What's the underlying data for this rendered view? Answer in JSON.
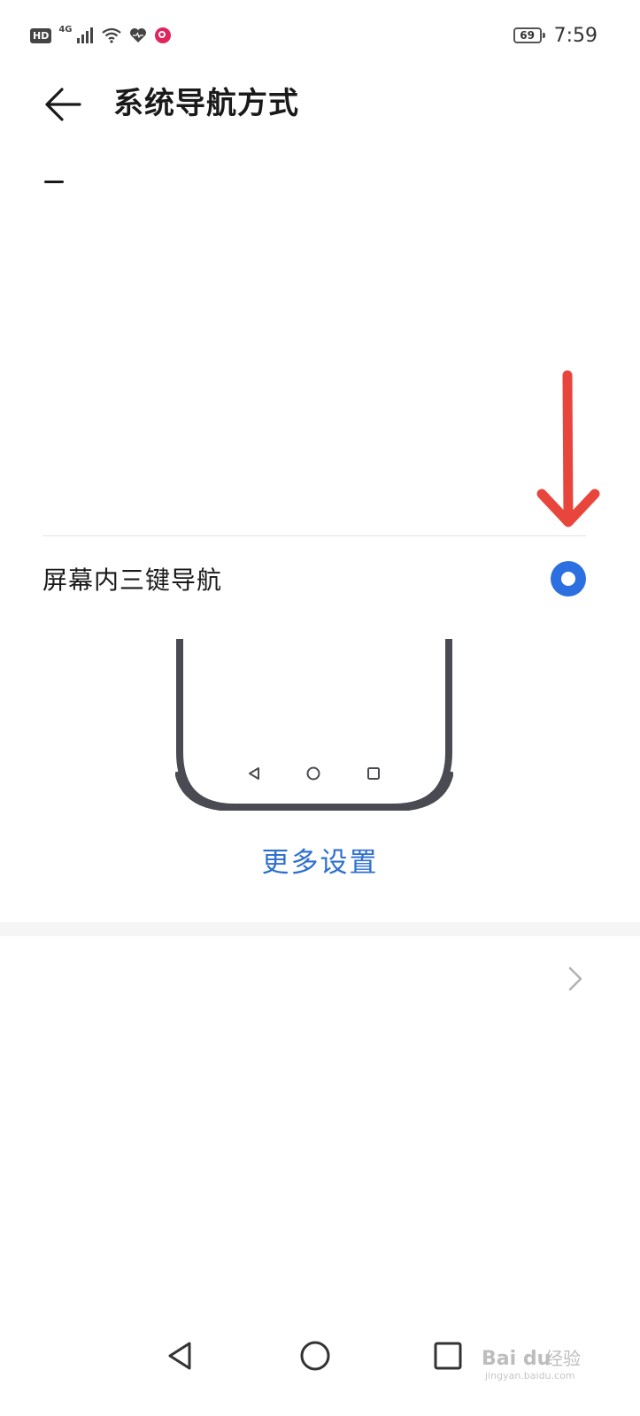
{
  "status_bar": {
    "hd_badge": "HD",
    "network": "4G",
    "battery": "69",
    "time": "7:59",
    "icons": [
      "signal-icon",
      "wifi-icon",
      "heart-icon",
      "app-notification-icon"
    ]
  },
  "header": {
    "title": "系统导航方式",
    "back_icon": "back-arrow-icon"
  },
  "option": {
    "label": "屏幕内三键导航",
    "selected": true
  },
  "more_settings_label": "更多设置",
  "colors": {
    "accent": "#2c6fe0",
    "link": "#2f6fd0",
    "annotation_arrow": "#e8453c",
    "phone_frame": "#4a4a52"
  },
  "system_nav": {
    "icons": [
      "nav-back-icon",
      "nav-home-icon",
      "nav-recents-icon"
    ]
  },
  "watermark": {
    "brand": "Bai du 经验",
    "url": "jingyan.baidu.com"
  }
}
